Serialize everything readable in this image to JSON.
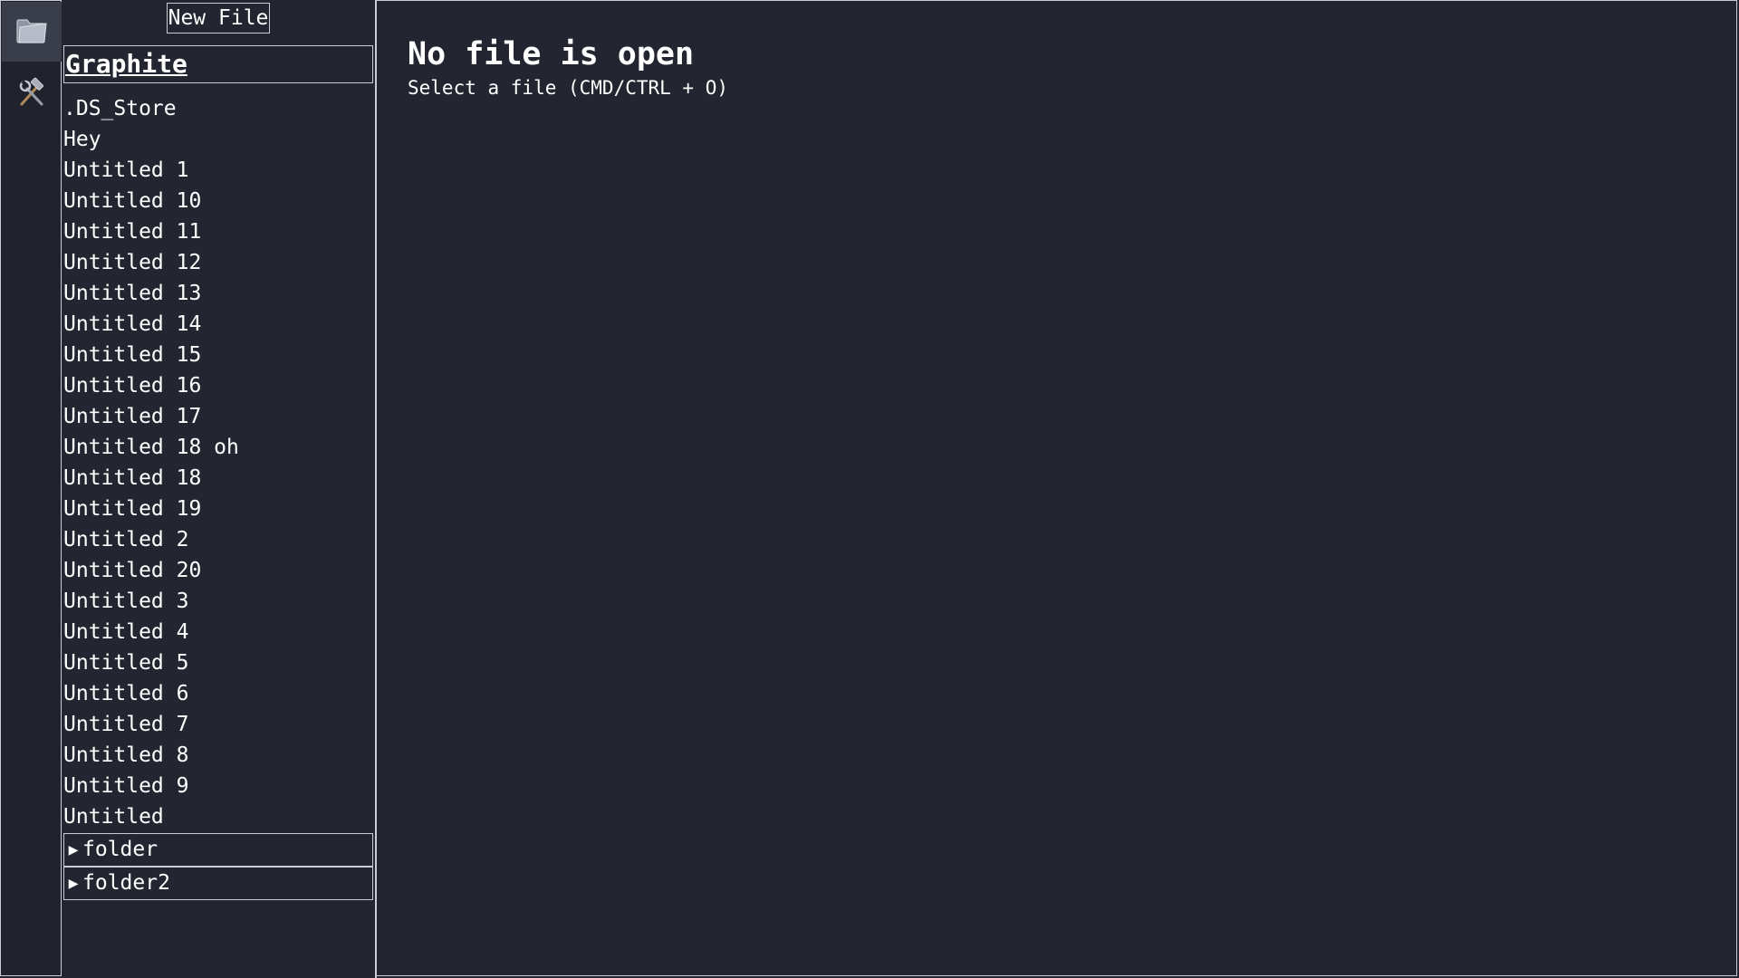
{
  "activity_bar": {
    "items": [
      {
        "icon": "folder-icon",
        "active": true
      },
      {
        "icon": "tools-icon",
        "active": false
      }
    ]
  },
  "sidebar": {
    "new_file_label": "New File",
    "vault_name": "Graphite",
    "files": [
      ".DS_Store",
      "Hey",
      "Untitled 1",
      "Untitled 10",
      "Untitled 11",
      "Untitled 12",
      "Untitled 13",
      "Untitled 14",
      "Untitled 15",
      "Untitled 16",
      "Untitled 17",
      "Untitled 18 oh",
      "Untitled 18",
      "Untitled 19",
      "Untitled 2",
      "Untitled 20",
      "Untitled 3",
      "Untitled 4",
      "Untitled 5",
      "Untitled 6",
      "Untitled 7",
      "Untitled 8",
      "Untitled 9",
      "Untitled"
    ],
    "folders": [
      {
        "caret": "▶",
        "name": "folder"
      },
      {
        "caret": "▶",
        "name": "folder2"
      }
    ]
  },
  "main": {
    "empty_title": "No file is open",
    "empty_subtitle": "Select a file (CMD/CTRL + O)"
  },
  "colors": {
    "background": "#232630",
    "border": "#c9ccd3",
    "text": "#ffffff",
    "active_activity": "#3a3e4a"
  }
}
